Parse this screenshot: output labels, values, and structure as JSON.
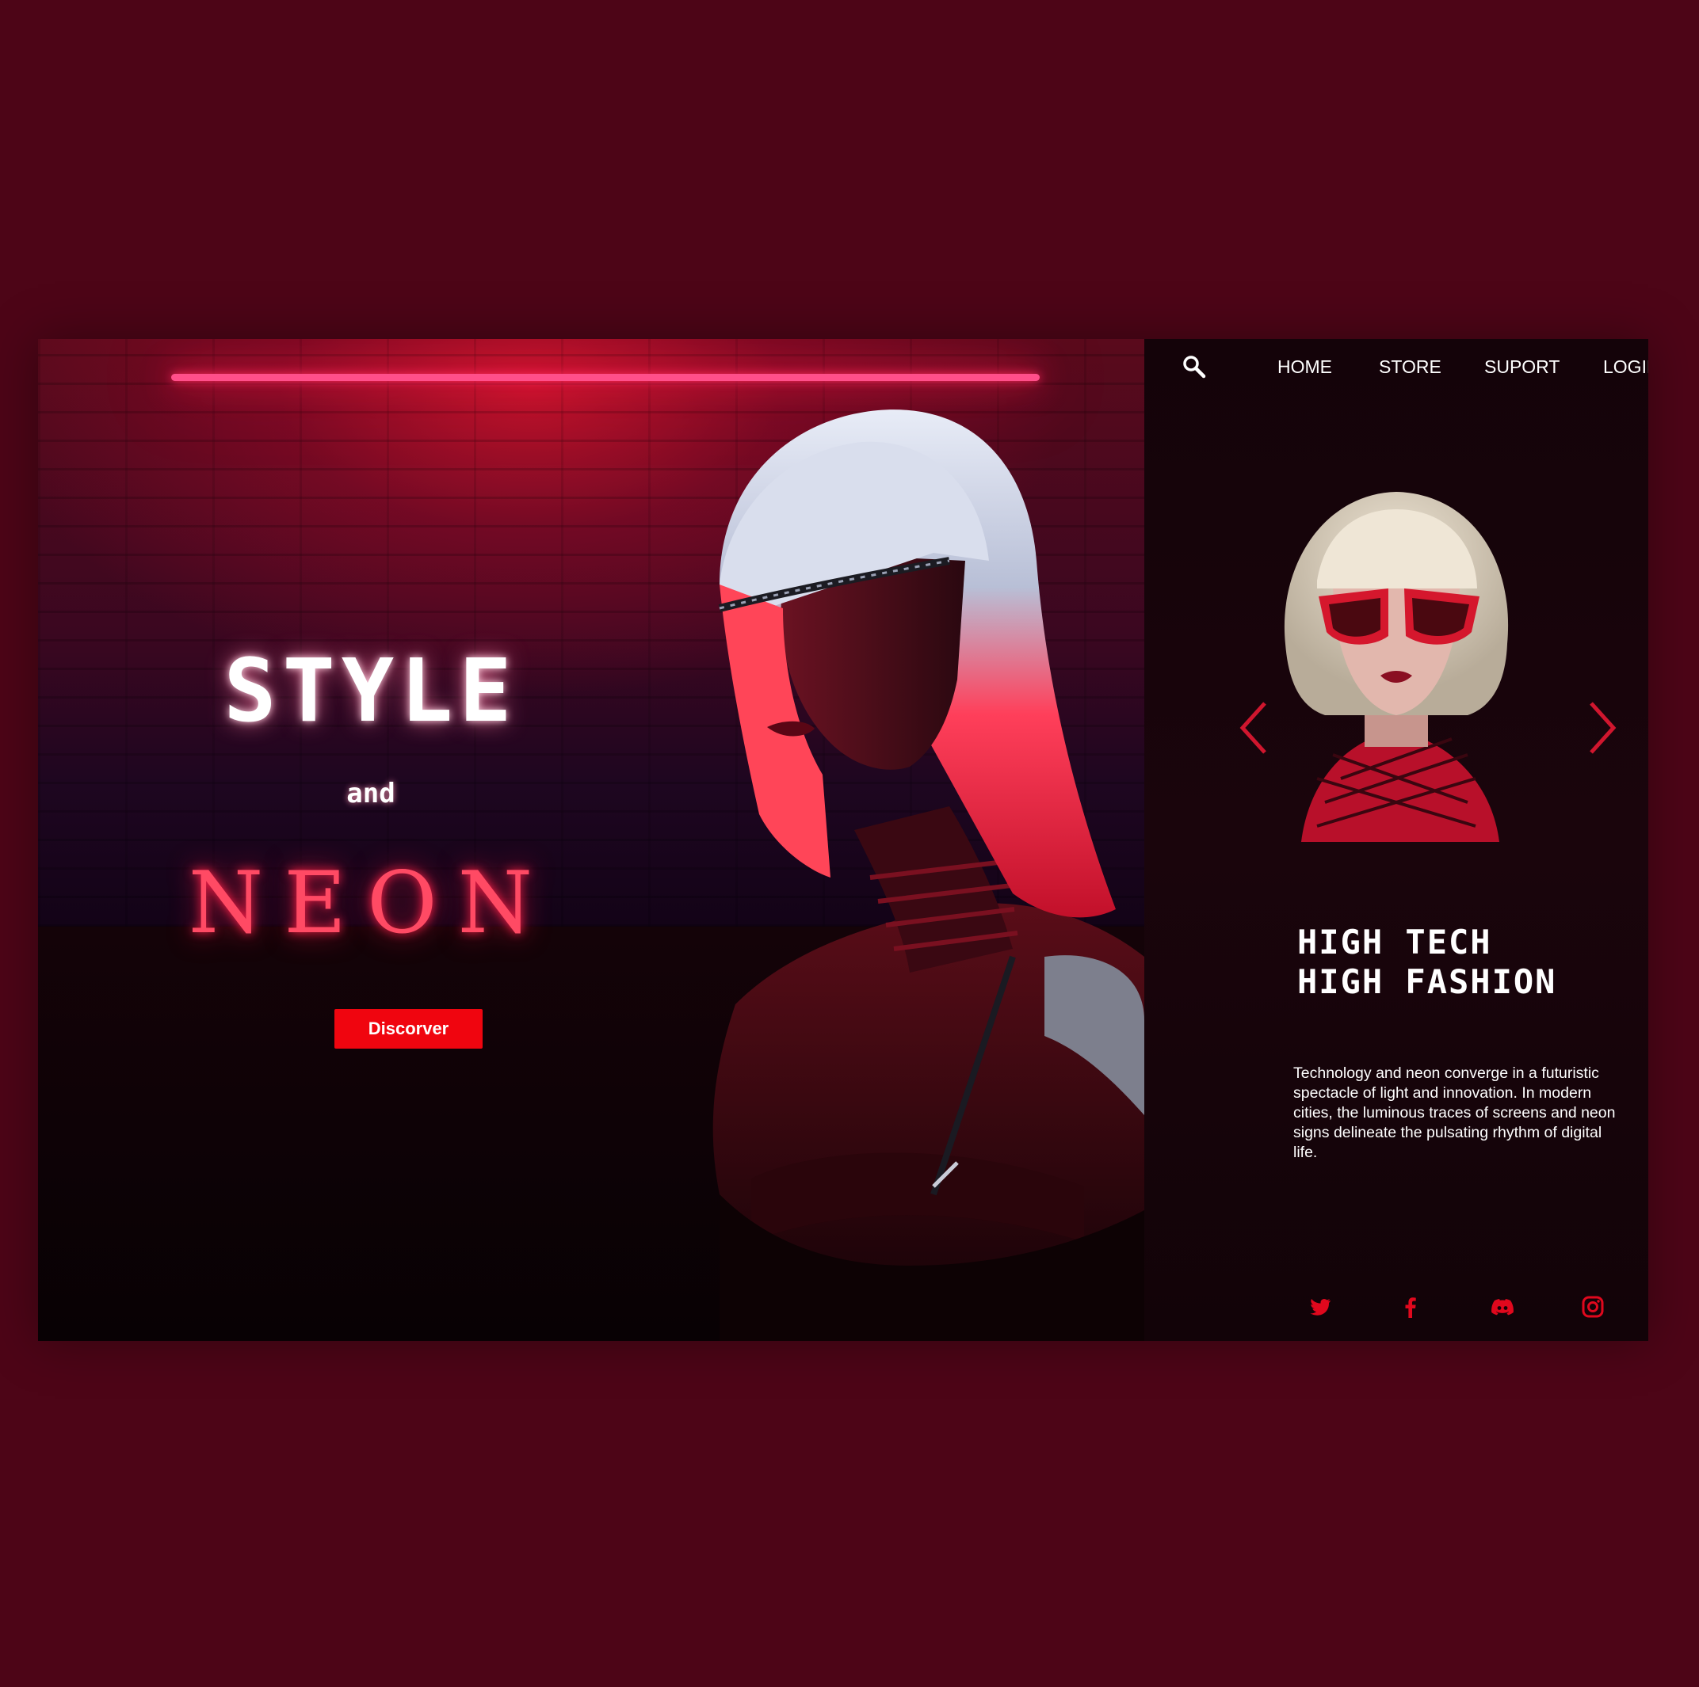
{
  "hero": {
    "title_line1": "STYLE",
    "title_line2": "and",
    "title_line3": "NEON",
    "cta_label": "Discorver"
  },
  "nav": {
    "search_icon": "search-icon",
    "items": [
      {
        "label": "HOME"
      },
      {
        "label": "STORE"
      },
      {
        "label": "SUPORT"
      },
      {
        "label": "LOGIN"
      }
    ]
  },
  "carousel": {
    "prev_icon": "chevron-left-icon",
    "next_icon": "chevron-right-icon"
  },
  "feature": {
    "headline_line1": "HIGH TECH",
    "headline_line2": "HIGH FASHION",
    "description": "Technology and neon converge in a futuristic spectacle of light and innovation. In modern cities, the luminous traces of screens and neon signs delineate the pulsating rhythm of digital life."
  },
  "socials": [
    {
      "icon": "twitter-icon"
    },
    {
      "icon": "facebook-icon"
    },
    {
      "icon": "discord-icon"
    },
    {
      "icon": "instagram-icon"
    }
  ],
  "colors": {
    "background": "#4d0517",
    "accent": "#f0050f",
    "neon": "#ff4a64",
    "panel": "#140309"
  }
}
